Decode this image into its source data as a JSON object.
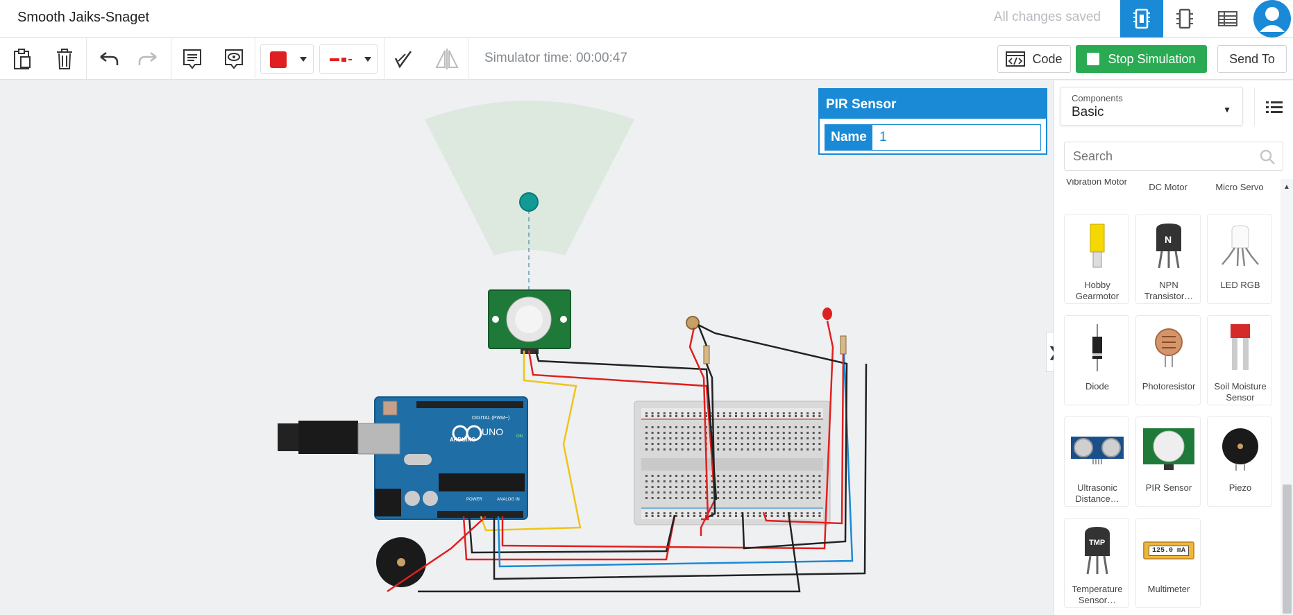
{
  "app": {
    "project_title": "Smooth Jaiks-Snaget",
    "save_status": "All changes saved",
    "view_buttons": [
      "circuit-view-icon",
      "schematic-view-icon",
      "component-list-view-icon"
    ],
    "accent_color": "#1a8ad6"
  },
  "toolbar": {
    "simulator_time": "Simulator time: 00:00:47",
    "code_label": "Code",
    "stop_label": "Stop Simulation",
    "send_label": "Send To",
    "wire_color": "#e02020",
    "stop_color": "#2aab53"
  },
  "inspector": {
    "title": "PIR Sensor",
    "name_label": "Name",
    "name_value": "1"
  },
  "panel": {
    "category_label": "Components",
    "category_value": "Basic",
    "search_placeholder": "Search",
    "partial_row": [
      "Vibration Motor",
      "DC Motor",
      "Micro Servo"
    ],
    "components": [
      {
        "name": "Hobby Gearmotor",
        "icon": "gearmotor-icon"
      },
      {
        "name": "NPN Transistor…",
        "icon": "npn-transistor-icon"
      },
      {
        "name": "LED RGB",
        "icon": "rgb-led-icon"
      },
      {
        "name": "Diode",
        "icon": "diode-icon"
      },
      {
        "name": "Photoresistor",
        "icon": "photoresistor-icon"
      },
      {
        "name": "Soil Moisture Sensor",
        "icon": "soil-moisture-icon"
      },
      {
        "name": "Ultrasonic Distance…",
        "icon": "ultrasonic-icon"
      },
      {
        "name": "PIR Sensor",
        "icon": "pir-sensor-icon"
      },
      {
        "name": "Piezo",
        "icon": "piezo-icon"
      },
      {
        "name": "Temperature Sensor…",
        "icon": "temperature-sensor-icon"
      },
      {
        "name": "Multimeter",
        "icon": "multimeter-icon"
      }
    ],
    "multimeter_reading": "125.0 mA"
  },
  "circuit": {
    "arduino_brand": "ARDUINO",
    "arduino_model": "UNO",
    "digital_label": "DIGITAL (PWM~)",
    "power_label": "POWER",
    "analog_label": "ANALOG IN",
    "on_label": "ON",
    "transistor_letter": "N",
    "temp_label": "TMP"
  }
}
